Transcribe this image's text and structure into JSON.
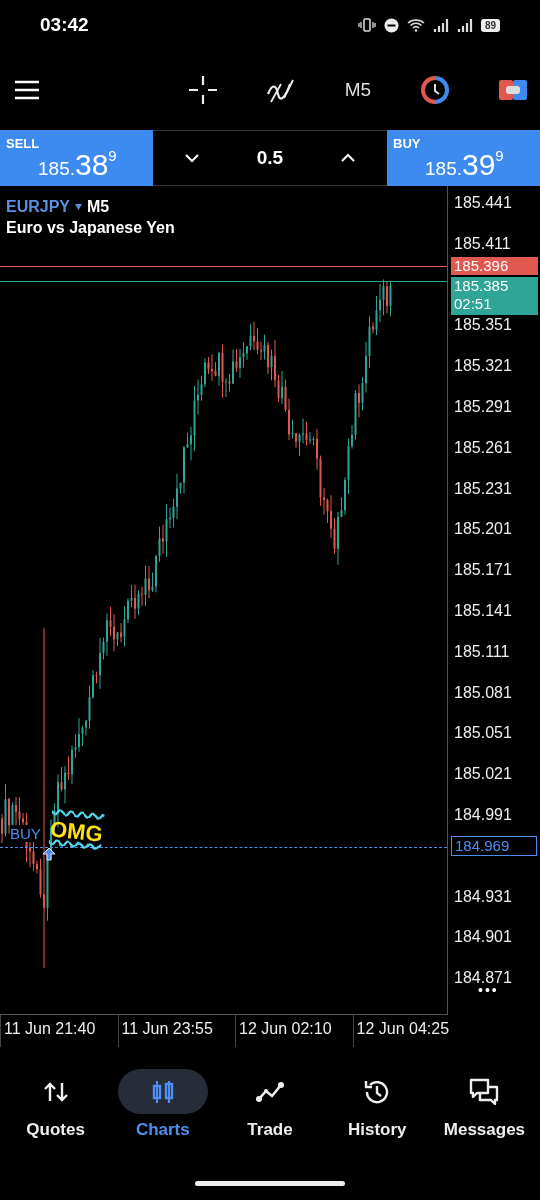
{
  "status_bar": {
    "time": "03:42",
    "battery": "89"
  },
  "toolbar": {
    "timeframe": "M5"
  },
  "trade_panel": {
    "sell": {
      "label": "SELL",
      "price_small": "185.",
      "price_big": "38",
      "price_sup": "9"
    },
    "volume": "0.5",
    "buy": {
      "label": "BUY",
      "price_small": "185.",
      "price_big": "39",
      "price_sup": "9"
    }
  },
  "chart": {
    "symbol": "EURJPY",
    "timeframe": "M5",
    "description": "Euro vs Japanese Yen",
    "price_ticks": [
      "185.441",
      "185.411",
      "185.351",
      "185.321",
      "185.291",
      "185.261",
      "185.231",
      "185.201",
      "185.171",
      "185.141",
      "185.111",
      "185.081",
      "185.051",
      "185.021",
      "184.991",
      "184.931",
      "184.901",
      "184.871"
    ],
    "price_lines": [
      {
        "kind": "ask",
        "label": "185.396",
        "color": "#e0584f"
      },
      {
        "kind": "bid",
        "label": "185.385",
        "countdown": "02:51",
        "color": "#2ea596"
      }
    ],
    "order": {
      "label": "BUY",
      "price": "184.969"
    },
    "sticker": "OMG",
    "more": "•••",
    "time_ticks": [
      "11 Jun 21:40",
      "11 Jun 23:55",
      "12 Jun 02:10",
      "12 Jun 04:25"
    ]
  },
  "nav": [
    {
      "label": "Quotes",
      "selected": false
    },
    {
      "label": "Charts",
      "selected": true
    },
    {
      "label": "Trade",
      "selected": false
    },
    {
      "label": "History",
      "selected": false
    },
    {
      "label": "Messages",
      "selected": false
    }
  ]
}
